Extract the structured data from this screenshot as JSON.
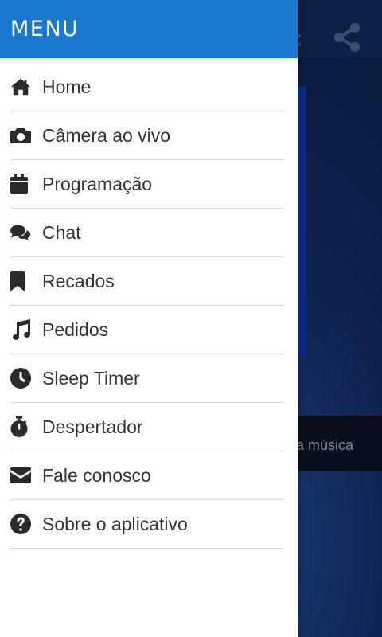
{
  "background": {
    "now_playing_text": "a música"
  },
  "drawer": {
    "title": "MENU",
    "items": [
      {
        "label": "Home",
        "icon": "home-icon"
      },
      {
        "label": "Câmera ao vivo",
        "icon": "camera-icon"
      },
      {
        "label": "Programação",
        "icon": "calendar-icon"
      },
      {
        "label": "Chat",
        "icon": "chat-icon"
      },
      {
        "label": "Recados",
        "icon": "bookmark-icon"
      },
      {
        "label": "Pedidos",
        "icon": "music-note-icon"
      },
      {
        "label": "Sleep Timer",
        "icon": "clock-icon"
      },
      {
        "label": "Despertador",
        "icon": "stopwatch-icon"
      },
      {
        "label": "Fale conosco",
        "icon": "envelope-icon"
      },
      {
        "label": "Sobre o aplicativo",
        "icon": "question-circle-icon"
      }
    ]
  },
  "colors": {
    "header": "#1a79cf",
    "icon": "#2b2b2b",
    "text": "#333333",
    "divider": "#d9d9d9"
  }
}
